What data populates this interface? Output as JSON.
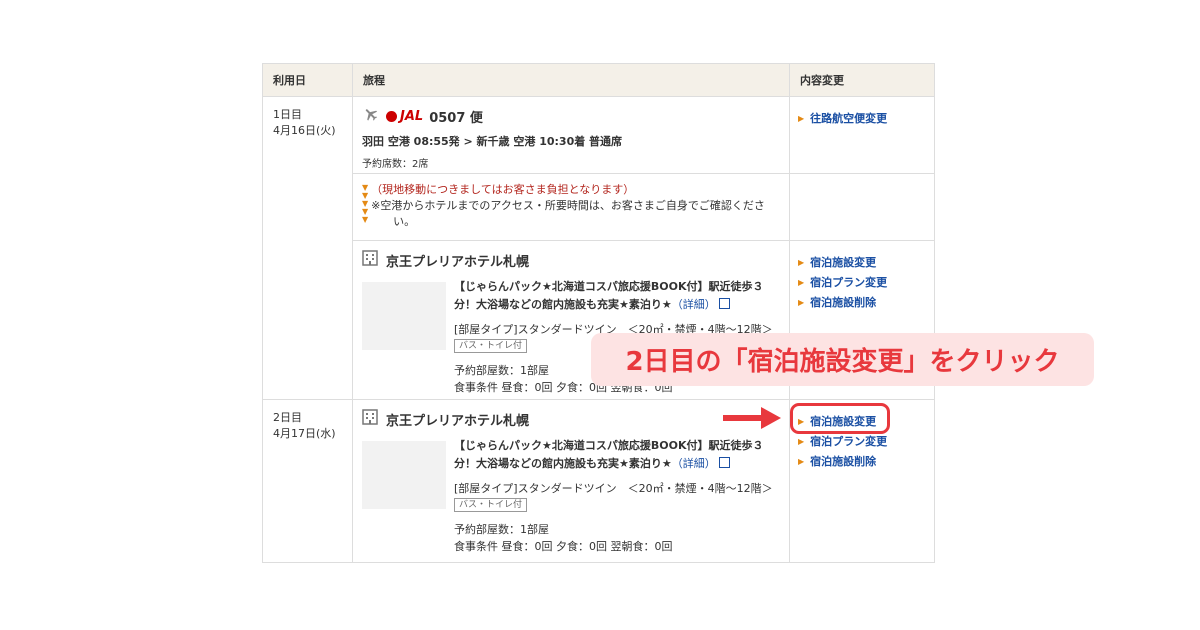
{
  "table": {
    "headers": {
      "date": "利用日",
      "itinerary": "旅程",
      "change": "内容変更"
    }
  },
  "day1": {
    "day_label": "1日目",
    "date": "4月16日(火)",
    "flight": {
      "airline": "JAL",
      "number": "0507 便",
      "route": "羽田 空港  08:55発 > 新千歳 空港  10:30着  普通席",
      "seats": "予約席数：2席"
    },
    "flight_change": "往路航空便変更",
    "notes": {
      "line1": "（現地移動につきましてはお客さま負担となります）",
      "line2": "※空港からホテルまでのアクセス・所要時間は、お客さまご自身でご確認くださ",
      "line3": "い。"
    },
    "hotel": {
      "name": "京王プレリアホテル札幌",
      "plan_title": "【じゃらんパック★北海道コスパ旅応援BOOK付】駅近徒歩３分！大浴場などの館内施設も充実★素泊り★",
      "detail_link": "（詳細）",
      "room_type": "[部屋タイプ]スタンダードツイン　＜20㎡・禁煙・4階〜12階＞",
      "badge": "バス・トイレ付",
      "rooms": "予約部屋数：1部屋",
      "meals": "食事条件 昼食：0回  夕食：0回  翌朝食：0回"
    },
    "hotel_changes": [
      "宿泊施設変更",
      "宿泊プラン変更",
      "宿泊施設削除"
    ]
  },
  "day2": {
    "day_label": "2日目",
    "date": "4月17日(水)",
    "hotel": {
      "name": "京王プレリアホテル札幌",
      "plan_title": "【じゃらんパック★北海道コスパ旅応援BOOK付】駅近徒歩３分！大浴場などの館内施設も充実★素泊り★",
      "detail_link": "（詳細）",
      "room_type": "[部屋タイプ]スタンダードツイン　＜20㎡・禁煙・4階〜12階＞",
      "badge": "バス・トイレ付",
      "rooms": "予約部屋数：1部屋",
      "meals": "食事条件 昼食：0回  夕食：0回  翌朝食：0回"
    },
    "hotel_changes": [
      "宿泊施設変更",
      "宿泊プラン変更",
      "宿泊施設削除"
    ]
  },
  "annotation": {
    "callout": "2日目の「宿泊施設変更」をクリック"
  },
  "colors": {
    "accent_red": "#e8383d",
    "link_blue": "#1a4fa3",
    "triangle_orange": "#e48a15",
    "header_bg": "#f4f0e8"
  }
}
